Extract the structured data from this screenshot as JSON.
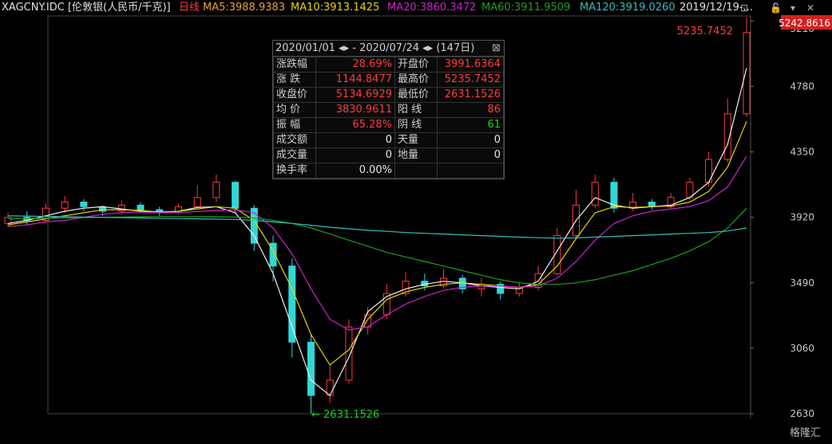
{
  "header": {
    "symbol": "XAGCNY.IDC [伦敦银(人民币/千克)]",
    "period": "日线",
    "ma5": "MA5:3988.9383",
    "ma10": "MA10:3913.1425",
    "ma20": "MA20:3860.3472",
    "ma60": "MA60:3911.9509",
    "ma120": "MA120:3919.0260",
    "date_range": "2019/12/19-..."
  },
  "colors": {
    "up": "#ff3b3b",
    "down": "#33d6d6",
    "ma5": "#f0f0f0",
    "ma10": "#e8d400",
    "ma20": "#d020d0",
    "ma60": "#1f9f1f",
    "ma120": "#30c0c0",
    "axis_text": "#c8c8c8"
  },
  "popup": {
    "range": "2020/01/01 ◂▸ - 2020/07/24 ◂▸",
    "days": "(147日)",
    "rows": [
      [
        "涨跌幅",
        "28.69%",
        "开盘价",
        "3991.6364"
      ],
      [
        "涨  跌",
        "1144.8477",
        "最高价",
        "5235.7452"
      ],
      [
        "收盘价",
        "5134.6929",
        "最低价",
        "2631.1526"
      ],
      [
        "均  价",
        "3830.9611",
        "阳  线",
        "86"
      ],
      [
        "振  幅",
        "65.28%",
        "阴  线",
        "61"
      ],
      [
        "成交额",
        "0",
        "天量",
        "0"
      ],
      [
        "成交量",
        "0",
        "地量",
        "0"
      ],
      [
        "换手率",
        "0.00%",
        "",
        ""
      ]
    ]
  },
  "chart_data": {
    "type": "line",
    "title": "XAGCNY.IDC [伦敦银(人民币/千克)]",
    "y_axis_ticks": [
      "5210",
      "4780",
      "4350",
      "3920",
      "3490",
      "3060",
      "2630"
    ],
    "ylim": [
      2630,
      5242.8616
    ],
    "current_price": "5242.8616",
    "high_label": "5235.7452",
    "low_label": "← 2631.1526",
    "series": [
      {
        "name": "MA5:3988.9383",
        "values": [
          3880,
          3900,
          3930,
          3960,
          3980,
          3990,
          3975,
          3960,
          3950,
          3960,
          3985,
          3990,
          3950,
          3800,
          3550,
          3200,
          2850,
          2750,
          3000,
          3300,
          3400,
          3450,
          3480,
          3500,
          3490,
          3470,
          3460,
          3450,
          3500,
          3700,
          3900,
          4050,
          4000,
          3980,
          3990,
          4000,
          4050,
          4150,
          4400,
          4900
        ]
      },
      {
        "name": "MA10:3913.1425",
        "values": [
          3870,
          3890,
          3910,
          3930,
          3950,
          3970,
          3970,
          3965,
          3955,
          3960,
          3975,
          3990,
          3980,
          3900,
          3700,
          3450,
          3150,
          2950,
          3050,
          3250,
          3380,
          3430,
          3460,
          3480,
          3490,
          3480,
          3470,
          3460,
          3480,
          3600,
          3780,
          3950,
          3990,
          3985,
          3990,
          3995,
          4020,
          4090,
          4250,
          4550
        ]
      },
      {
        "name": "MA20:3860.3472",
        "values": [
          3860,
          3870,
          3890,
          3900,
          3920,
          3940,
          3950,
          3955,
          3950,
          3952,
          3958,
          3965,
          3970,
          3950,
          3850,
          3680,
          3450,
          3250,
          3180,
          3200,
          3280,
          3350,
          3400,
          3440,
          3460,
          3470,
          3470,
          3460,
          3470,
          3520,
          3630,
          3770,
          3880,
          3930,
          3960,
          3975,
          3990,
          4030,
          4120,
          4320
        ]
      },
      {
        "name": "MA60:3911.9509",
        "values": [
          3910,
          3912,
          3914,
          3916,
          3918,
          3920,
          3922,
          3924,
          3925,
          3925,
          3925,
          3924,
          3922,
          3915,
          3900,
          3880,
          3850,
          3810,
          3770,
          3730,
          3690,
          3660,
          3630,
          3600,
          3570,
          3540,
          3510,
          3490,
          3480,
          3480,
          3490,
          3510,
          3540,
          3570,
          3610,
          3650,
          3700,
          3760,
          3850,
          3980
        ]
      },
      {
        "name": "MA120:3919.0260",
        "values": [
          3930,
          3928,
          3926,
          3924,
          3922,
          3920,
          3918,
          3916,
          3914,
          3912,
          3910,
          3908,
          3906,
          3900,
          3890,
          3880,
          3868,
          3855,
          3845,
          3835,
          3828,
          3820,
          3815,
          3810,
          3805,
          3800,
          3795,
          3790,
          3786,
          3783,
          3785,
          3790,
          3795,
          3800,
          3805,
          3810,
          3815,
          3820,
          3830,
          3850
        ]
      }
    ],
    "candles": [
      [
        3880,
        3920,
        3860,
        3950
      ],
      [
        3920,
        3900,
        3870,
        3960
      ],
      [
        3900,
        3980,
        3890,
        4010
      ],
      [
        3980,
        4020,
        3950,
        4060
      ],
      [
        4020,
        3990,
        3960,
        4040
      ],
      [
        3990,
        3960,
        3930,
        4000
      ],
      [
        3960,
        4000,
        3940,
        4030
      ],
      [
        4000,
        3970,
        3950,
        4020
      ],
      [
        3970,
        3960,
        3930,
        3990
      ],
      [
        3960,
        3990,
        3950,
        4010
      ],
      [
        3990,
        4050,
        3980,
        4130
      ],
      [
        4050,
        4150,
        4020,
        4200
      ],
      [
        4150,
        3980,
        3950,
        4160
      ],
      [
        3980,
        3750,
        3700,
        4000
      ],
      [
        3750,
        3600,
        3500,
        3800
      ],
      [
        3600,
        3100,
        3000,
        3650
      ],
      [
        3100,
        2750,
        2631,
        3150
      ],
      [
        2750,
        2850,
        2700,
        2950
      ],
      [
        2850,
        3200,
        2830,
        3250
      ],
      [
        3200,
        3280,
        3150,
        3330
      ],
      [
        3280,
        3420,
        3250,
        3480
      ],
      [
        3420,
        3500,
        3400,
        3560
      ],
      [
        3500,
        3470,
        3440,
        3550
      ],
      [
        3470,
        3520,
        3450,
        3580
      ],
      [
        3520,
        3450,
        3420,
        3540
      ],
      [
        3450,
        3480,
        3400,
        3520
      ],
      [
        3480,
        3420,
        3380,
        3500
      ],
      [
        3420,
        3460,
        3400,
        3490
      ],
      [
        3460,
        3550,
        3440,
        3600
      ],
      [
        3550,
        3800,
        3540,
        3850
      ],
      [
        3800,
        4000,
        3780,
        4100
      ],
      [
        4000,
        4150,
        3980,
        4200
      ],
      [
        4150,
        3980,
        3950,
        4180
      ],
      [
        3980,
        4020,
        3960,
        4080
      ],
      [
        4020,
        3990,
        3970,
        4040
      ],
      [
        3990,
        4050,
        3980,
        4080
      ],
      [
        4050,
        4150,
        4030,
        4180
      ],
      [
        4150,
        4300,
        4120,
        4350
      ],
      [
        4300,
        4600,
        4280,
        4700
      ],
      [
        4600,
        5134,
        4580,
        5235
      ]
    ]
  }
}
